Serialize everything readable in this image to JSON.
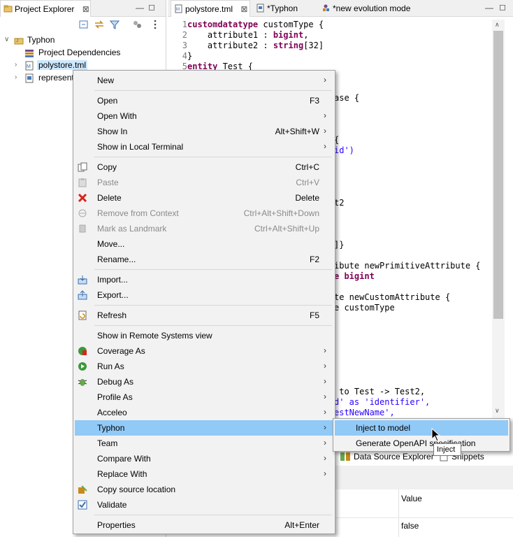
{
  "explorer": {
    "tab_title": "Project Explorer",
    "close_glyph": "⊠",
    "tree": [
      {
        "label": "Typhon",
        "icon": "project-icon"
      },
      {
        "label": "Project Dependencies",
        "icon": "dependencies-icon"
      },
      {
        "label": "polystore.tml",
        "icon": "tml-file-icon"
      },
      {
        "label": "represent",
        "icon": "file-icon"
      }
    ]
  },
  "editor": {
    "tabs": [
      {
        "label": "polystore.tml",
        "close": "⊠"
      },
      {
        "label": "*Typhon"
      },
      {
        "label": "*new evolution mode"
      }
    ],
    "code_lines": [
      {
        "n": "1",
        "segments": [
          {
            "t": "customdatatype",
            "c": "kw"
          },
          {
            "t": " customType {",
            "c": ""
          }
        ]
      },
      {
        "n": "2",
        "segments": [
          {
            "t": "    attribute1 : ",
            "c": ""
          },
          {
            "t": "bigint",
            "c": "kw"
          },
          {
            "t": ",",
            "c": ""
          }
        ]
      },
      {
        "n": "3",
        "segments": [
          {
            "t": "    attribute2 : ",
            "c": ""
          },
          {
            "t": "string",
            "c": "kw"
          },
          {
            "t": "[32]",
            "c": ""
          }
        ]
      },
      {
        "n": "4",
        "segments": [
          {
            "t": "}",
            "c": ""
          }
        ]
      },
      {
        "n": "5",
        "segments": [
          {
            "t": "entity",
            "c": "kw"
          },
          {
            "t": " Test {",
            "c": ""
          }
        ]
      }
    ],
    "peek_fragments": [
      {
        "t": "ase {",
        "c": ""
      },
      {
        "t": "{",
        "c": ""
      },
      {
        "t": "id')",
        "c": "str"
      },
      {
        "t": "t2",
        "c": ""
      },
      {
        "t": "]}",
        "c": ""
      },
      {
        "t": "ibute newPrimitiveAttribute {",
        "c": ""
      },
      {
        "t": "e bigint",
        "c": "kw"
      },
      {
        "t": "te newCustomAttribute {",
        "c": ""
      },
      {
        "t": "e customType",
        "c": ""
      },
      {
        "t": " to Test -> Test2,",
        "c": ""
      },
      {
        "t": "d' as 'identifier',",
        "c": "str"
      },
      {
        "t": "estNewName',",
        "c": "str"
      }
    ]
  },
  "bottom": {
    "tabs": [
      "Data Source Explorer",
      "Snippets"
    ],
    "props_header": "Value",
    "props_value": "false"
  },
  "context_menu": {
    "groups": [
      [
        {
          "label": "New",
          "accel": "",
          "submenu": true,
          "icon": "",
          "disabled": false
        }
      ],
      [
        {
          "label": "Open",
          "accel": "F3",
          "submenu": false,
          "icon": "",
          "disabled": false
        },
        {
          "label": "Open With",
          "accel": "",
          "submenu": true,
          "icon": "",
          "disabled": false
        },
        {
          "label": "Show In",
          "accel": "Alt+Shift+W",
          "submenu": true,
          "icon": "",
          "disabled": false
        },
        {
          "label": "Show in Local Terminal",
          "accel": "",
          "submenu": true,
          "icon": "",
          "disabled": false
        }
      ],
      [
        {
          "label": "Copy",
          "accel": "Ctrl+C",
          "submenu": false,
          "icon": "copy-icon",
          "disabled": false
        },
        {
          "label": "Paste",
          "accel": "Ctrl+V",
          "submenu": false,
          "icon": "paste-icon",
          "disabled": true
        },
        {
          "label": "Delete",
          "accel": "Delete",
          "submenu": false,
          "icon": "delete-icon",
          "disabled": false
        },
        {
          "label": "Remove from Context",
          "accel": "Ctrl+Alt+Shift+Down",
          "submenu": false,
          "icon": "remove-context-icon",
          "disabled": true
        },
        {
          "label": "Mark as Landmark",
          "accel": "Ctrl+Alt+Shift+Up",
          "submenu": false,
          "icon": "landmark-icon",
          "disabled": true
        },
        {
          "label": "Move...",
          "accel": "",
          "submenu": false,
          "icon": "",
          "disabled": false
        },
        {
          "label": "Rename...",
          "accel": "F2",
          "submenu": false,
          "icon": "",
          "disabled": false
        }
      ],
      [
        {
          "label": "Import...",
          "accel": "",
          "submenu": false,
          "icon": "import-icon",
          "disabled": false
        },
        {
          "label": "Export...",
          "accel": "",
          "submenu": false,
          "icon": "export-icon",
          "disabled": false
        }
      ],
      [
        {
          "label": "Refresh",
          "accel": "F5",
          "submenu": false,
          "icon": "refresh-icon",
          "disabled": false
        }
      ],
      [
        {
          "label": "Show in Remote Systems view",
          "accel": "",
          "submenu": false,
          "icon": "",
          "disabled": false
        },
        {
          "label": "Coverage As",
          "accel": "",
          "submenu": true,
          "icon": "coverage-icon",
          "disabled": false
        },
        {
          "label": "Run As",
          "accel": "",
          "submenu": true,
          "icon": "run-icon",
          "disabled": false
        },
        {
          "label": "Debug As",
          "accel": "",
          "submenu": true,
          "icon": "debug-icon",
          "disabled": false
        },
        {
          "label": "Profile As",
          "accel": "",
          "submenu": true,
          "icon": "",
          "disabled": false
        },
        {
          "label": "Acceleo",
          "accel": "",
          "submenu": true,
          "icon": "",
          "disabled": false
        },
        {
          "label": "Typhon",
          "accel": "",
          "submenu": true,
          "icon": "",
          "disabled": false,
          "highlighted": true
        },
        {
          "label": "Team",
          "accel": "",
          "submenu": true,
          "icon": "",
          "disabled": false
        },
        {
          "label": "Compare With",
          "accel": "",
          "submenu": true,
          "icon": "",
          "disabled": false
        },
        {
          "label": "Replace With",
          "accel": "",
          "submenu": true,
          "icon": "",
          "disabled": false
        },
        {
          "label": "Copy source location",
          "accel": "",
          "submenu": false,
          "icon": "copy-location-icon",
          "disabled": false
        },
        {
          "label": "Validate",
          "accel": "",
          "submenu": false,
          "icon": "validate-icon",
          "disabled": false
        }
      ],
      [
        {
          "label": "Properties",
          "accel": "Alt+Enter",
          "submenu": false,
          "icon": "",
          "disabled": false
        }
      ]
    ]
  },
  "submenu": {
    "items": [
      {
        "label": "Inject to model",
        "highlighted": true
      },
      {
        "label": "Generate OpenAPI specification",
        "highlighted": false
      }
    ]
  },
  "tooltip": {
    "text": "Inject"
  },
  "colors": {
    "menu_bg": "#f2f2f2",
    "menu_highlight": "#91c9f7",
    "keyword": "#7f0055",
    "string": "#2a00ff",
    "selection": "#cce8ff"
  }
}
